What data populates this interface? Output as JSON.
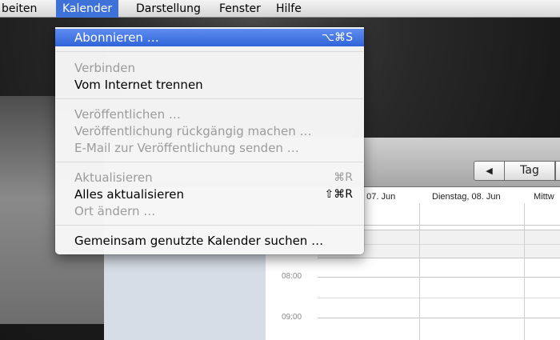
{
  "menubar": {
    "items": [
      "beiten",
      "Kalender",
      "Darstellung",
      "Fenster",
      "Hilfe"
    ]
  },
  "kalender_menu": {
    "items": [
      {
        "label": "Abonnieren …",
        "shortcut": "⌥⌘S"
      },
      {
        "label": "Verbinden",
        "shortcut": ""
      },
      {
        "label": "Vom Internet trennen",
        "shortcut": ""
      },
      {
        "label": "Veröffentlichen …",
        "shortcut": ""
      },
      {
        "label": "Veröffentlichung rückgängig machen …",
        "shortcut": ""
      },
      {
        "label": "E-Mail zur Veröffentlichung senden …",
        "shortcut": ""
      },
      {
        "label": "Aktualisieren",
        "shortcut": "⌘R"
      },
      {
        "label": "Alles aktualisieren",
        "shortcut": "⇧⌘R"
      },
      {
        "label": "Ort ändern …",
        "shortcut": ""
      },
      {
        "label": "Gemeinsam genutzte Kalender suchen …",
        "shortcut": ""
      }
    ]
  },
  "calendar": {
    "view_button": "Tag",
    "prev_arrow": "◀",
    "day_headers": [
      ", 07. Jun",
      "Dienstag, 08. Jun",
      "Mittw"
    ],
    "times": [
      "08:00",
      "09:00"
    ]
  },
  "colors": {
    "highlight": "#3f72d9",
    "disabled_text": "#9b9b9b"
  }
}
